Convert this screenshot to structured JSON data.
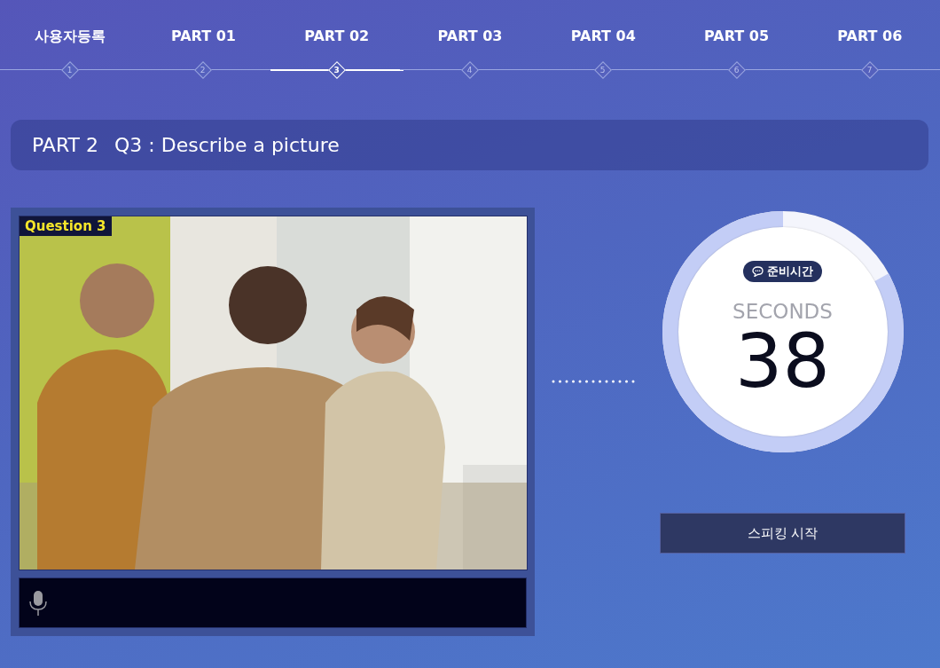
{
  "steps": [
    {
      "label": "사용자등록",
      "number": "1",
      "selected": false
    },
    {
      "label": "PART 01",
      "number": "2",
      "selected": false
    },
    {
      "label": "PART 02",
      "number": "3",
      "selected": true
    },
    {
      "label": "PART 03",
      "number": "4",
      "selected": false
    },
    {
      "label": "PART 04",
      "number": "5",
      "selected": false
    },
    {
      "label": "PART 05",
      "number": "6",
      "selected": false
    },
    {
      "label": "PART 06",
      "number": "7",
      "selected": false
    }
  ],
  "title": {
    "part": "PART 2",
    "question": "Q3 : Describe a picture"
  },
  "picture": {
    "badge": "Question 3"
  },
  "timer": {
    "badge": "준비시간",
    "unit": "SECONDS",
    "value": "38",
    "level": 0.83
  },
  "start_button": "스피킹 시작"
}
